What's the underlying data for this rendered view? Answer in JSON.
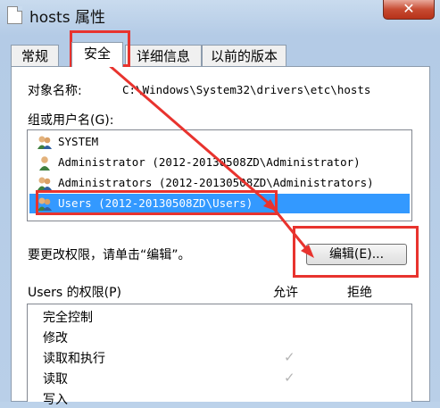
{
  "window": {
    "title": "hosts 属性",
    "close_glyph": "✕"
  },
  "tabs": [
    {
      "label": "常规"
    },
    {
      "label": "安全"
    },
    {
      "label": "详细信息"
    },
    {
      "label": "以前的版本"
    }
  ],
  "security": {
    "object_label": "对象名称:",
    "object_value": "C:\\Windows\\System32\\drivers\\etc\\hosts",
    "groups_label": "组或用户名(G):",
    "users": [
      {
        "name": "SYSTEM",
        "selected": false
      },
      {
        "name": "Administrator (2012-20130508ZD\\Administrator)",
        "selected": false
      },
      {
        "name": "Administrators (2012-20130508ZD\\Administrators)",
        "selected": false
      },
      {
        "name": "Users (2012-20130508ZD\\Users)",
        "selected": true
      }
    ],
    "change_hint": "要更改权限，请单击“编辑”。",
    "edit_button": "编辑(E)...",
    "perm_label": "Users 的权限(P)",
    "allow_header": "允许",
    "deny_header": "拒绝",
    "permissions": [
      {
        "name": "完全控制",
        "allow": ""
      },
      {
        "name": "修改",
        "allow": ""
      },
      {
        "name": "读取和执行",
        "allow": "✓"
      },
      {
        "name": "读取",
        "allow": "✓"
      },
      {
        "name": "写入",
        "allow": ""
      }
    ]
  },
  "annotation_color": "#e8332e",
  "selection_color": "#3399ff"
}
